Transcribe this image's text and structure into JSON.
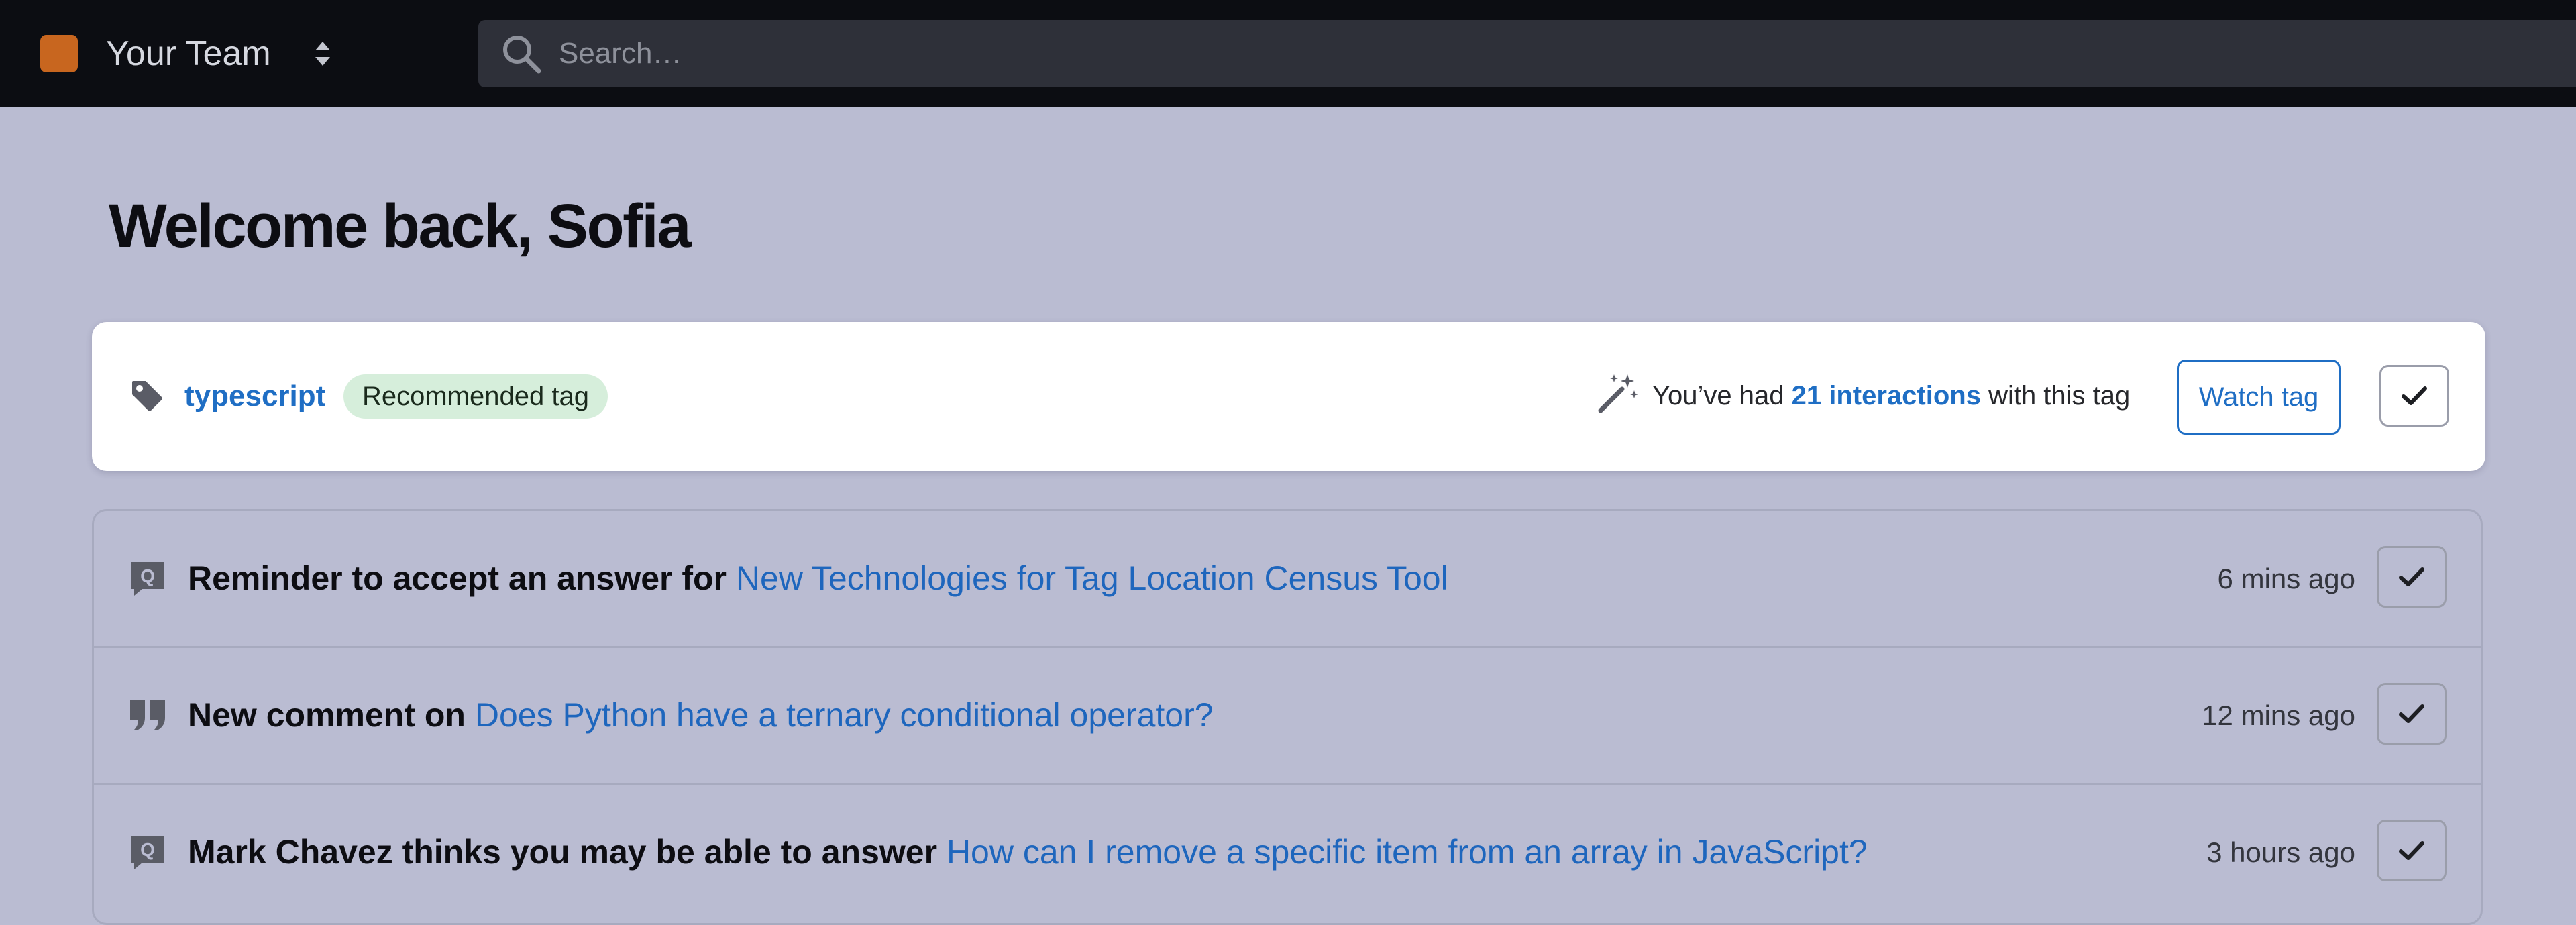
{
  "topbar": {
    "team_name": "Your Team",
    "team_logo_color": "#c8661f",
    "search_placeholder": "Search…"
  },
  "page_title": "Welcome back, Sofia",
  "recommendation": {
    "tag_name": "typescript",
    "badge_label": "Recommended tag",
    "interaction_prefix": "You’ve had",
    "interaction_count": "21 interactions",
    "interaction_suffix": "with this tag",
    "watch_button_label": "Watch tag"
  },
  "activity": [
    {
      "icon": "question-icon",
      "lead": "Reminder to accept an answer for",
      "link": "New Technologies for Tag Location Census Tool",
      "time": "6 mins ago"
    },
    {
      "icon": "comment-quote-icon",
      "lead": "New comment on",
      "link": "Does Python have a ternary conditional operator?",
      "time": "12 mins ago"
    },
    {
      "icon": "question-icon",
      "lead": "Mark Chavez thinks you may be able to answer",
      "link": "How can I remove a specific item from an array in JavaScript?",
      "time": "3 hours ago"
    }
  ],
  "colors": {
    "page_background": "#babcd2",
    "topbar_background": "#0c0d12",
    "link_blue": "#1f6ec4",
    "badge_green": "#d6eedb"
  }
}
